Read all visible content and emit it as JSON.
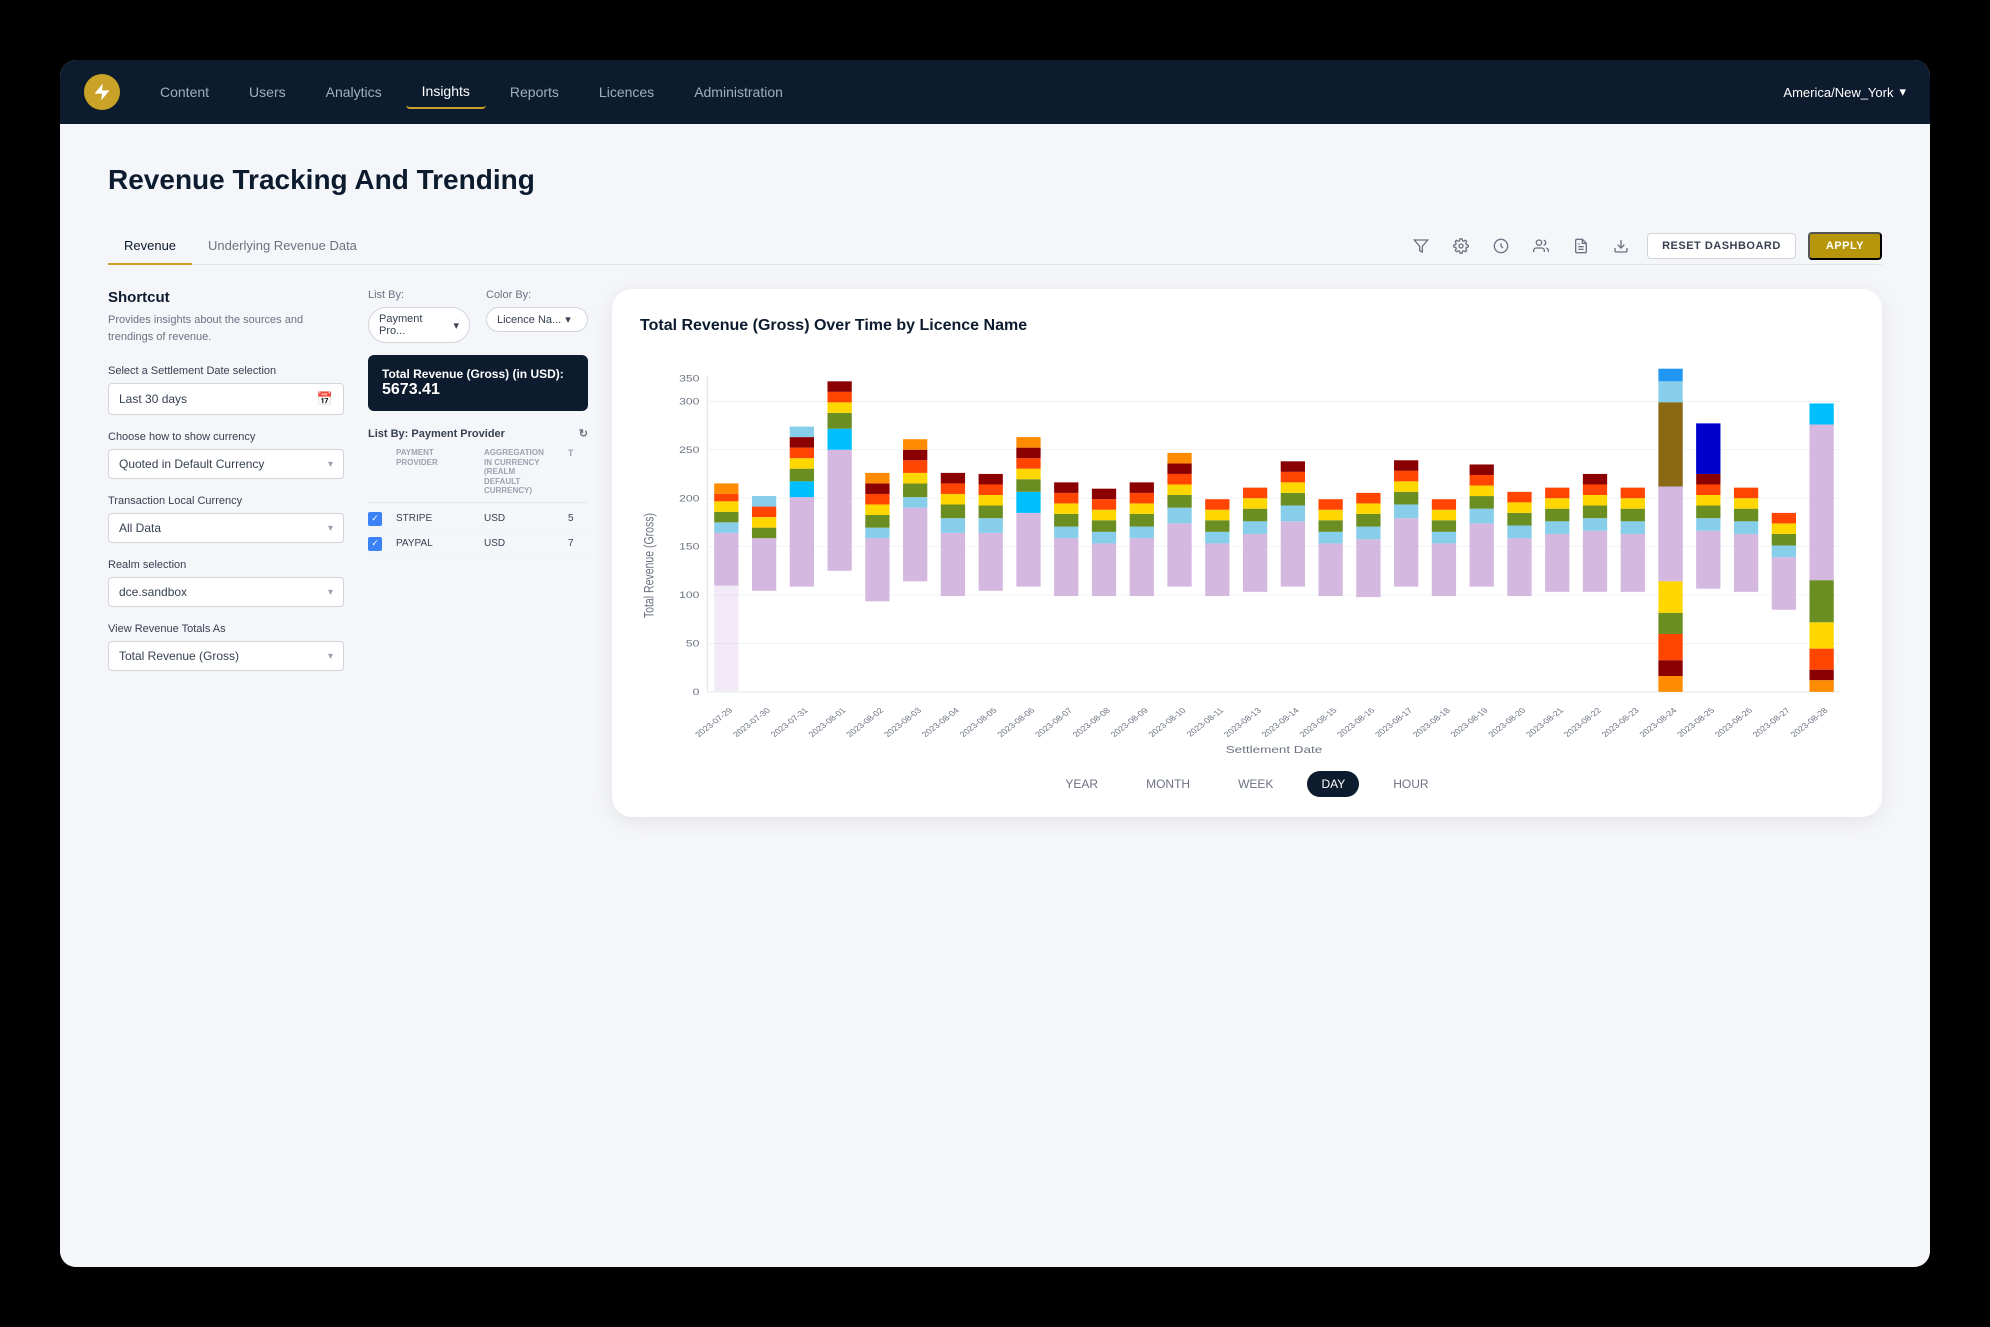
{
  "navbar": {
    "logo": "⚡",
    "items": [
      {
        "label": "Content",
        "active": false
      },
      {
        "label": "Users",
        "active": false
      },
      {
        "label": "Analytics",
        "active": false
      },
      {
        "label": "Insights",
        "active": true
      },
      {
        "label": "Reports",
        "active": false
      },
      {
        "label": "Licences",
        "active": false
      },
      {
        "label": "Administration",
        "active": false
      }
    ],
    "timezone_label": "America/New_York",
    "timezone_chevron": "▾"
  },
  "page": {
    "title": "Revenue Tracking And Trending"
  },
  "tabs": {
    "items": [
      {
        "label": "Revenue",
        "active": true
      },
      {
        "label": "Underlying Revenue Data",
        "active": false
      }
    ],
    "actions": {
      "reset_label": "RESET DASHBOARD",
      "apply_label": "APPLY"
    }
  },
  "shortcut": {
    "title": "Shortcut",
    "description": "Provides insights about the sources and trendings of revenue."
  },
  "form": {
    "settlement_label": "Select a Settlement Date selection",
    "settlement_value": "Last 30 days",
    "currency_label": "Choose how to show currency",
    "currency_value": "Quoted in Default Currency",
    "transaction_label": "Transaction Local Currency",
    "transaction_value": "All Data",
    "realm_label": "Realm selection",
    "realm_value": "dce.sandbox",
    "view_label": "View Revenue Totals As",
    "view_value": "Total Revenue (Gross)"
  },
  "list_color": {
    "list_by_label": "List By:",
    "list_by_value": "Payment Pro...",
    "color_by_label": "Color By:",
    "color_by_value": "Licence Na..."
  },
  "total_revenue": {
    "label": "Total Revenue (Gross) (in USD):",
    "value": "5673.41"
  },
  "list_by_section": {
    "title": "List By: Payment Provider",
    "refresh_icon": "↻",
    "columns": [
      "",
      "PAYMENT PROVIDER",
      "AGGREGATION IN CURRENCY (REALM DEFAULT CURRENCY)",
      "T"
    ],
    "rows": [
      {
        "checked": true,
        "name": "STRIPE",
        "currency": "USD",
        "num": "5"
      },
      {
        "checked": true,
        "name": "PAYPAL",
        "currency": "USD",
        "num": "7"
      }
    ]
  },
  "chart": {
    "title": "Total Revenue (Gross) Over Time by Licence Name",
    "y_label": "Total Revenue (Gross)",
    "x_label": "Settlement Date",
    "y_max": 350,
    "y_ticks": [
      0,
      50,
      100,
      150,
      200,
      250,
      300,
      350
    ],
    "dates": [
      "2023-07-29",
      "2023-07-30",
      "2023-07-31",
      "2023-08-01",
      "2023-08-02",
      "2023-08-03",
      "2023-08-04",
      "2023-08-05",
      "2023-08-06",
      "2023-08-07",
      "2023-08-08",
      "2023-08-09",
      "2023-08-10",
      "2023-08-11",
      "2023-08-13",
      "2023-08-14",
      "2023-08-15",
      "2023-08-16",
      "2023-08-17",
      "2023-08-18",
      "2023-08-19",
      "2023-08-20",
      "2023-08-21",
      "2023-08-22",
      "2023-08-23",
      "2023-08-24",
      "2023-08-25",
      "2023-08-26",
      "2023-08-27",
      "2023-08-28"
    ],
    "time_buttons": [
      "YEAR",
      "MONTH",
      "WEEK",
      "DAY",
      "HOUR"
    ],
    "active_time": "DAY"
  },
  "colors": {
    "nav_bg": "#0d1b2e",
    "accent": "#c9a227",
    "apply_btn": "#b8960c"
  }
}
